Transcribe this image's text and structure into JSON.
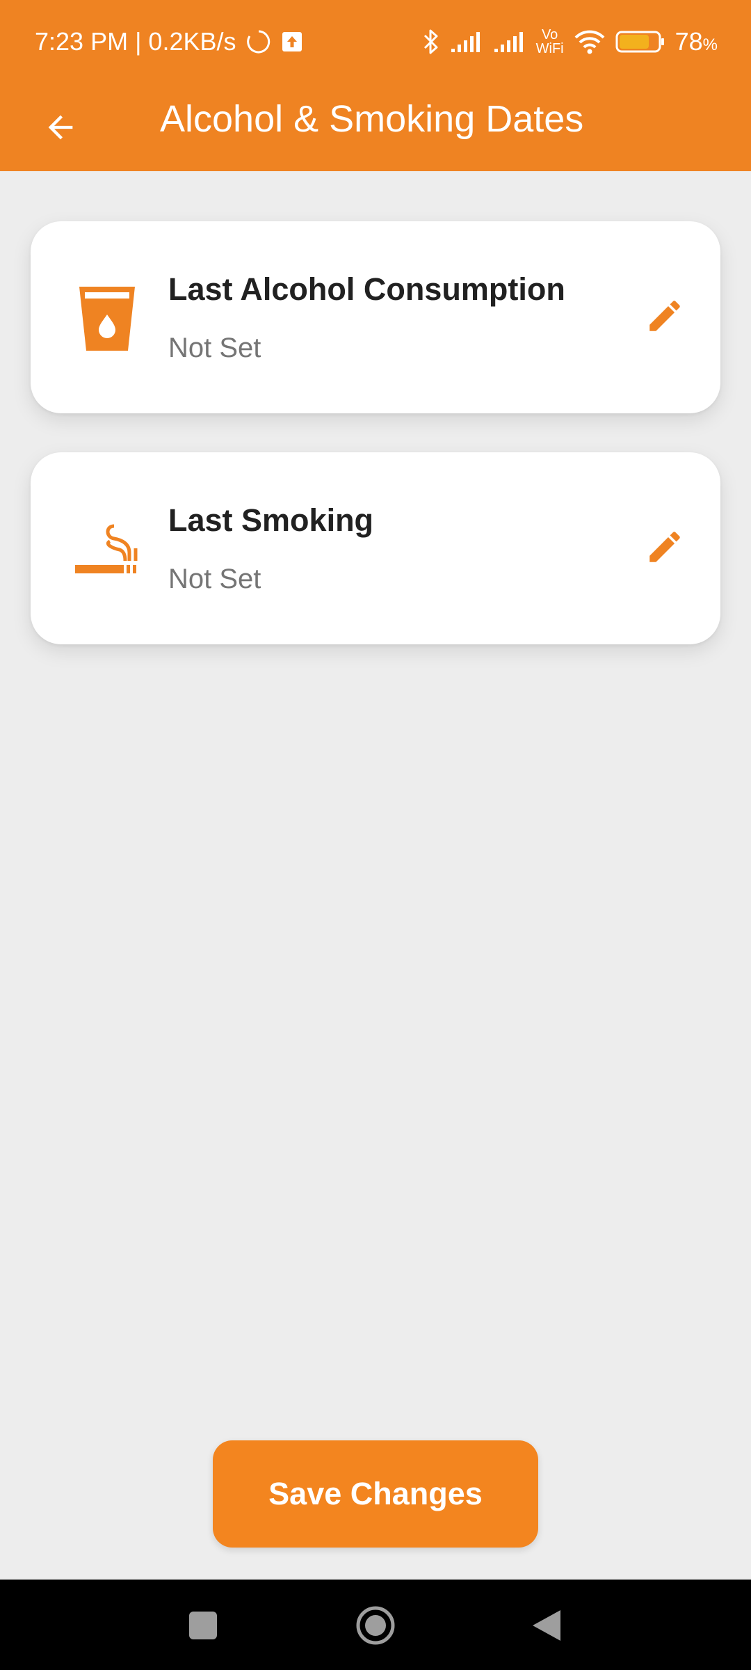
{
  "status_bar": {
    "time_speed": "7:23 PM | 0.2KB/s",
    "vowifi_top": "Vo",
    "vowifi_bottom": "WiFi",
    "battery_percent": "78",
    "battery_unit": "%",
    "battery_level": 0.78
  },
  "header": {
    "title": "Alcohol & Smoking Dates"
  },
  "cards": [
    {
      "title": "Last Alcohol Consumption",
      "value": "Not Set",
      "icon": "glass-drop-icon"
    },
    {
      "title": "Last Smoking",
      "value": "Not Set",
      "icon": "smoking-icon"
    }
  ],
  "actions": {
    "save_label": "Save Changes"
  },
  "colors": {
    "accent": "#ef8322",
    "background": "#ededed",
    "card": "#ffffff",
    "title_text": "#212121",
    "sub_text": "#757575"
  }
}
